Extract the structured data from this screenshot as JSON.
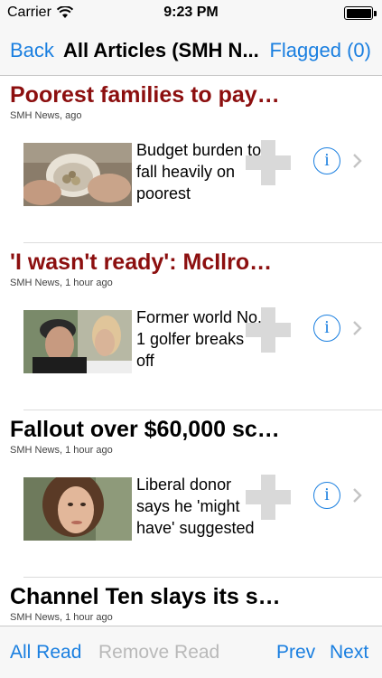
{
  "status_bar": {
    "carrier": "Carrier",
    "time": "9:23 PM",
    "icons": [
      "wifi-icon",
      "battery-icon"
    ]
  },
  "nav": {
    "back_label": "Back",
    "title": "All Articles (SMH N...",
    "flagged_label": "Flagged (0)"
  },
  "articles": [
    {
      "title": "Poorest families to pay…",
      "meta": "SMH News,  ago",
      "summary": "Budget burden to fall heavily on poorest",
      "title_color": "#8c0f0f"
    },
    {
      "title": "'I wasn't ready': McIlro…",
      "meta": "SMH News, 1 hour ago",
      "summary": "Former world No. 1 golfer breaks off",
      "title_color": "#8c0f0f"
    },
    {
      "title": "Fallout over $60,000 sc…",
      "meta": "SMH News, 1 hour ago",
      "summary": "Liberal donor says he 'might have' suggested",
      "title_color": "#000000"
    },
    {
      "title": "Channel Ten slays its s…",
      "meta": "SMH News, 1 hour ago",
      "title_color": "#000000"
    }
  ],
  "toolbar": {
    "all_read_label": "All Read",
    "remove_read_label": "Remove Read",
    "prev_label": "Prev",
    "next_label": "Next"
  },
  "colors": {
    "accent": "#1a7fe0",
    "unread_title": "#8c0f0f",
    "disabled": "#b9b9b9"
  }
}
